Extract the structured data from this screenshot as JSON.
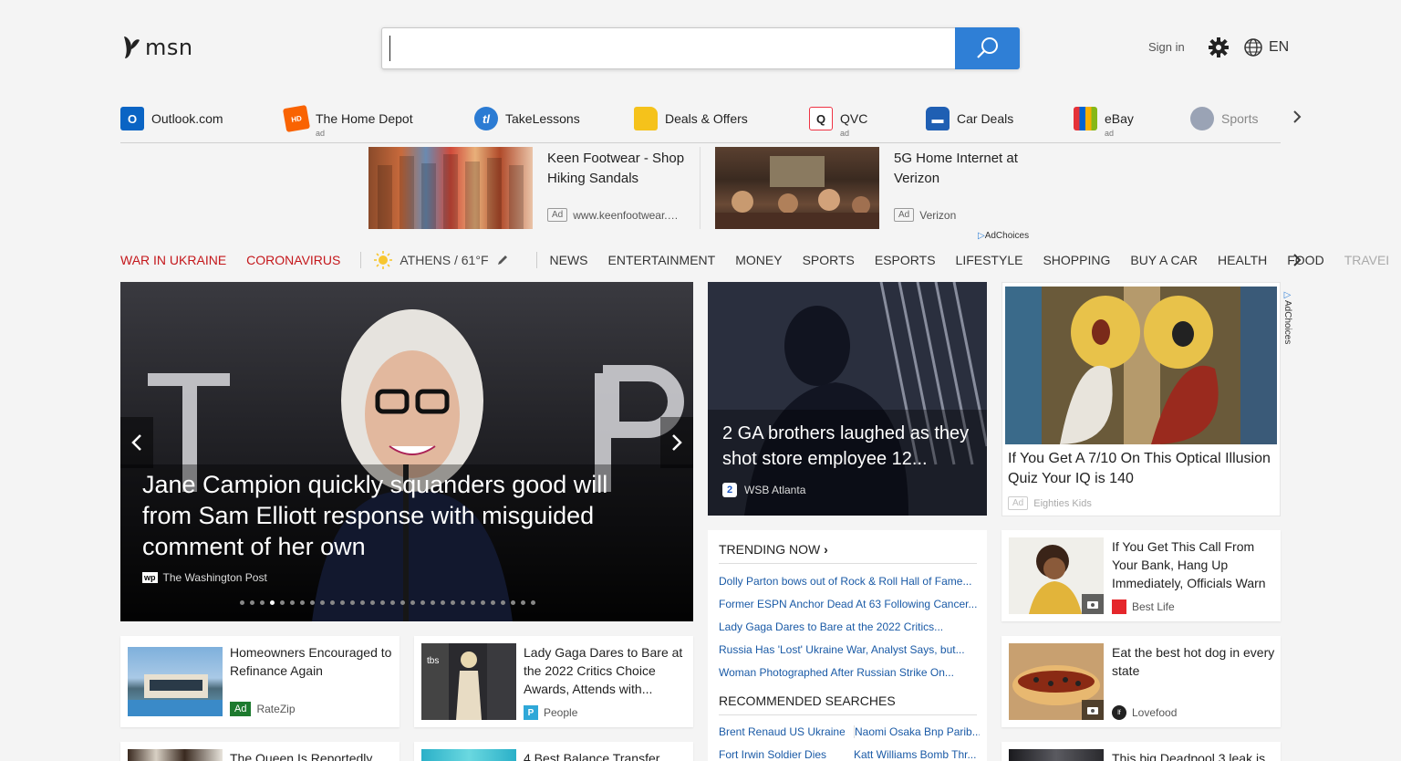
{
  "header": {
    "logo_text": "msn",
    "search_placeholder": "",
    "signin_label": "Sign in",
    "lang_label": "EN"
  },
  "quick_links": [
    {
      "label": "Outlook.com",
      "ad": ""
    },
    {
      "label": "The Home Depot",
      "ad": "ad"
    },
    {
      "label": "TakeLessons",
      "ad": ""
    },
    {
      "label": "Deals & Offers",
      "ad": ""
    },
    {
      "label": "QVC",
      "ad": "ad"
    },
    {
      "label": "Car Deals",
      "ad": ""
    },
    {
      "label": "eBay",
      "ad": "ad"
    },
    {
      "label": "Sports",
      "ad": ""
    }
  ],
  "top_ads": [
    {
      "title": "Keen Footwear - Shop Hiking Sandals",
      "badge": "Ad",
      "source": "www.keenfootwear.…"
    },
    {
      "title": "5G Home Internet at Verizon",
      "badge": "Ad",
      "source": "Verizon"
    }
  ],
  "adchoices": "AdChoices",
  "nav": {
    "hot": [
      "WAR IN UKRAINE",
      "CORONAVIRUS"
    ],
    "weather": "ATHENS / 61°F",
    "items": [
      "NEWS",
      "ENTERTAINMENT",
      "MONEY",
      "SPORTS",
      "ESPORTS",
      "LIFESTYLE",
      "SHOPPING",
      "BUY A CAR",
      "HEALTH",
      "FOOD",
      "TRAVEL"
    ]
  },
  "hero": {
    "title": "Jane Campion quickly squanders good will from Sam Elliott response with misguided comment of her own",
    "source": "The Washington Post",
    "slide_count": 30,
    "active_slide": 4
  },
  "card2": {
    "title": "2 GA brothers laughed as they shot store employee 12...",
    "source": "WSB Atlanta"
  },
  "side_ad": {
    "title": "If You Get A 7/10 On This Optical Illusion Quiz Your IQ is 140",
    "badge": "Ad",
    "source": "Eighties Kids"
  },
  "trending": {
    "heading": "TRENDING NOW",
    "items": [
      "Dolly Parton bows out of Rock & Roll Hall of Fame...",
      "Former ESPN Anchor Dead At 63 Following Cancer...",
      "Lady Gaga Dares to Bare at the 2022 Critics...",
      "Russia Has 'Lost' Ukraine War, Analyst Says, but...",
      "Woman Photographed After Russian Strike On..."
    ],
    "rec_heading": "RECOMMENDED SEARCHES",
    "rec_items": [
      "Brent Renaud US Ukraine",
      "Naomi Osaka Bnp Parib...",
      "Fort Irwin Soldier Dies",
      "Katt Williams Bomb Thr..."
    ]
  },
  "cards": [
    {
      "title": "Homeowners Encouraged to Refinance Again",
      "badge": "Ad",
      "source": "RateZip"
    },
    {
      "title": "Lady Gaga Dares to Bare at the 2022 Critics Choice Awards, Attends with...",
      "badge": "",
      "source": "People"
    },
    {
      "title": "If You Get This Call From Your Bank, Hang Up Immediately, Officials Warn",
      "badge": "",
      "source": "Best Life"
    },
    {
      "title": "Eat the best hot dog in every state",
      "badge": "",
      "source": "Lovefood"
    },
    {
      "title": "The Queen Is Reportedly",
      "badge": "",
      "source": ""
    },
    {
      "title": "4 Best Balance Transfer",
      "badge": "",
      "source": ""
    },
    {
      "title": "This big Deadpool 3 leak is",
      "badge": "",
      "source": ""
    }
  ]
}
